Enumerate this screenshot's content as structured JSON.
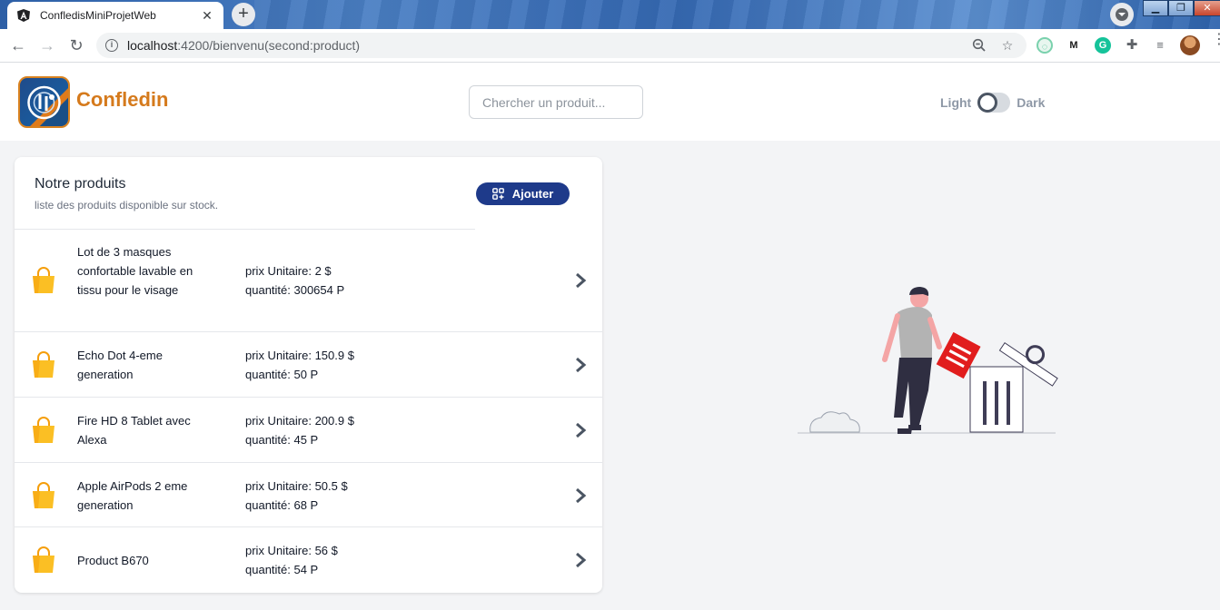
{
  "browser": {
    "tab_title": "ConfledisMiniProjetWeb",
    "new_tab": "+",
    "url_host": "localhost",
    "url_path": ":4200/bienvenu(second:product)"
  },
  "header": {
    "brand": "Confledin",
    "search_placeholder": "Chercher un produit...",
    "theme_light": "Light",
    "theme_dark": "Dark"
  },
  "products_card": {
    "title": "Notre produits",
    "subtitle": "liste des produits disponible sur stock.",
    "add_label": "Ajouter"
  },
  "products": [
    {
      "name": "Lot de 3 masques confortable lavable en tissu pour le visage",
      "price": "prix Unitaire: 2 $",
      "qty": "quantité: 300654 P"
    },
    {
      "name": "Echo Dot 4-eme generation",
      "price": "prix Unitaire: 150.9 $",
      "qty": "quantité: 50 P"
    },
    {
      "name": "Fire HD 8 Tablet avec Alexa",
      "price": "prix Unitaire: 200.9 $",
      "qty": "quantité: 45 P"
    },
    {
      "name": "Apple AirPods 2 eme generation",
      "price": "prix Unitaire: 50.5 $",
      "qty": "quantité: 68 P"
    },
    {
      "name": "Product B670",
      "price": "prix Unitaire: 56 $",
      "qty": "quantité: 54 P"
    }
  ],
  "colors": {
    "brand": "#d57a1c",
    "primary_button": "#1e3a8a",
    "bag_icon": "#fbbf24",
    "trash_paper": "#e11d1d"
  }
}
